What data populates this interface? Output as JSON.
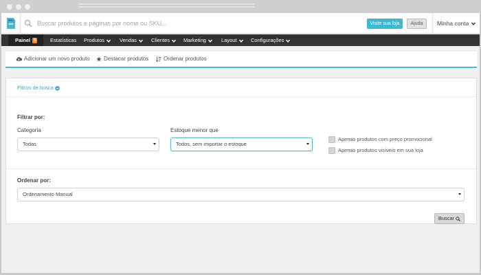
{
  "header": {
    "search_placeholder": "Buscar produtos e páginas por nome ou SKU...",
    "visit_store_label": "Visite sua loja",
    "help_label": "Ajuda",
    "account_label": "Minha conta"
  },
  "nav": {
    "items": [
      {
        "label": "Painel",
        "badge": "5"
      },
      {
        "label": "Estatísticas"
      },
      {
        "label": "Produtos"
      },
      {
        "label": "Vendas"
      },
      {
        "label": "Clientes"
      },
      {
        "label": "Marketing"
      },
      {
        "label": "Layout"
      },
      {
        "label": "Configurações"
      }
    ]
  },
  "subtabs": [
    {
      "label": "Adicionar um novo produto",
      "icon": "cloud-upload-icon"
    },
    {
      "label": "Destacar produtos",
      "icon": "star-icon"
    },
    {
      "label": "Ordenar produtos",
      "icon": "sort-icon"
    }
  ],
  "filters": {
    "title": "Filtros de busca",
    "filter_by_label": "Filtrar por:",
    "category": {
      "label": "Categoria",
      "value": "Todas"
    },
    "stock": {
      "label": "Estoque menor que",
      "value": "Todos, sem importar o estoque"
    },
    "checkboxes": [
      {
        "label": "Apenas produtos com preço promocional",
        "checked": false
      },
      {
        "label": "Apenas produtos visíveis em sua loja",
        "checked": false
      }
    ],
    "order_by_label": "Ordenar por:",
    "order": {
      "value": "Ordenamento Manual"
    },
    "search_button_label": "Buscar"
  },
  "colors": {
    "accent": "#3cb9d2",
    "navbar": "#333333",
    "badge": "#f08a2c",
    "filter_link": "#3aa5c4"
  }
}
